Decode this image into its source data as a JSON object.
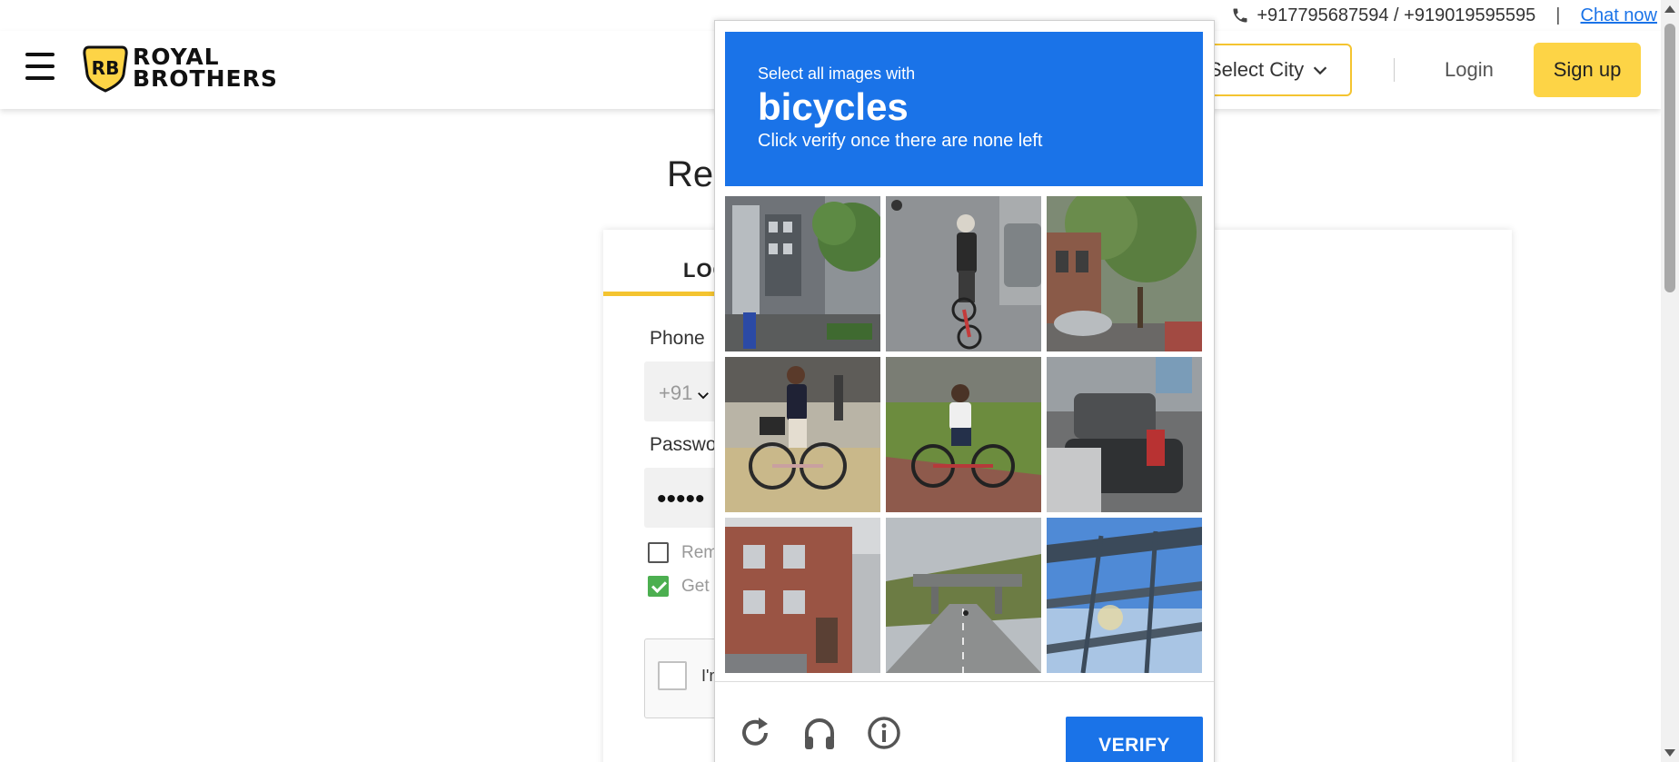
{
  "contact": {
    "phones": "+917795687594 / +919019595595",
    "separator": "|",
    "chat_label": "Chat now"
  },
  "header": {
    "logo_monogram": "RB",
    "logo_line1": "ROYAL",
    "logo_line2": "BROTHERS",
    "city_label": "Select City",
    "login_label": "Login",
    "signup_label": "Sign up"
  },
  "login_form": {
    "page_title": "Rer",
    "tab_login": "LOG",
    "phone_label": "Phone",
    "country_code": "+91",
    "password_label": "Passwo",
    "password_mask": "•••••",
    "remember_label": "Rem",
    "remember_checked": false,
    "updates_label": "Get",
    "updates_checked": true,
    "recaptcha_label": "I'm"
  },
  "captcha": {
    "instruction": "Select all images with",
    "target": "bicycles",
    "subtext": "Click verify once there are none left",
    "verify_label": "VERIFY",
    "footer_icons": [
      "reload-icon",
      "audio-icon",
      "info-icon"
    ],
    "accent_color": "#1a73e8"
  },
  "colors": {
    "brand_yellow": "#fdd446",
    "link_blue": "#1a73e8",
    "check_green": "#4caf50"
  }
}
